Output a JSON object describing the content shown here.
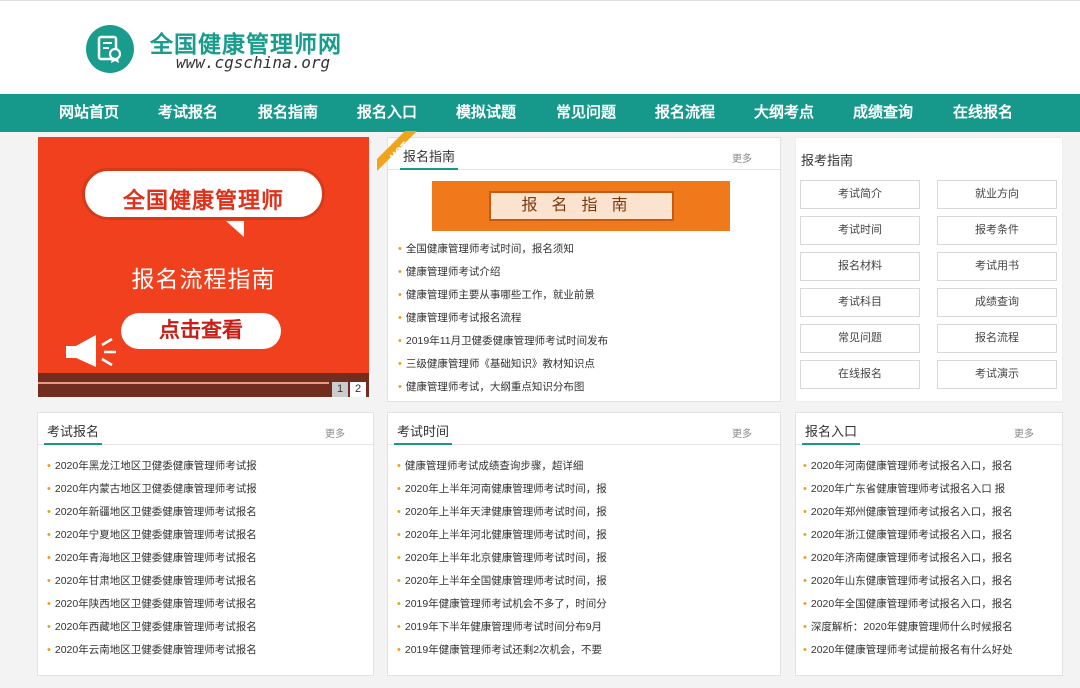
{
  "header": {
    "site_title": "全国健康管理师网",
    "site_url": "www.cgschina.org",
    "logo_icon": "certificate-icon",
    "brand_color": "#16998a"
  },
  "nav": [
    "网站首页",
    "考试报名",
    "报名指南",
    "报名入口",
    "模拟试题",
    "常见问题",
    "报名流程",
    "大纲考点",
    "成绩查询",
    "在线报名"
  ],
  "banner": {
    "bubble_text": "全国健康管理师",
    "subtitle": "报名流程指南",
    "button": "点击查看",
    "slides": [
      "1",
      "2"
    ]
  },
  "guide_panel": {
    "badge": "HOT",
    "title": "报名指南",
    "more": "更多",
    "banner_text": "报名指南",
    "items": [
      "全国健康管理师考试时间，报名须知",
      "健康管理师考试介绍",
      "健康管理师主要从事哪些工作，就业前景",
      "健康管理师考试报名流程",
      "2019年11月卫健委健康管理师考试时间发布",
      "三级健康管理师《基础知识》教材知识点",
      "健康管理师考试，大纲重点知识分布图"
    ]
  },
  "side_guide": {
    "title": "报考指南",
    "buttons": [
      "考试简介",
      "就业方向",
      "考试时间",
      "报考条件",
      "报名材料",
      "考试用书",
      "考试科目",
      "成绩查询",
      "常见问题",
      "报名流程",
      "在线报名",
      "考试演示"
    ]
  },
  "exam_registration": {
    "title": "考试报名",
    "more": "更多",
    "items": [
      "2020年黑龙江地区卫健委健康管理师考试报",
      "2020年内蒙古地区卫健委健康管理师考试报",
      "2020年新疆地区卫健委健康管理师考试报名",
      "2020年宁夏地区卫健委健康管理师考试报名",
      "2020年青海地区卫健委健康管理师考试报名",
      "2020年甘肃地区卫健委健康管理师考试报名",
      "2020年陕西地区卫健委健康管理师考试报名",
      "2020年西藏地区卫健委健康管理师考试报名",
      "2020年云南地区卫健委健康管理师考试报名"
    ]
  },
  "exam_time": {
    "title": "考试时间",
    "more": "更多",
    "items": [
      "健康管理师考试成绩查询步骤，超详细",
      "2020年上半年河南健康管理师考试时间，报",
      "2020年上半年天津健康管理师考试时间，报",
      "2020年上半年河北健康管理师考试时间，报",
      "2020年上半年北京健康管理师考试时间，报",
      "2020年上半年全国健康管理师考试时间，报",
      "2019年健康管理师考试机会不多了，时间分",
      "2019年下半年健康管理师考试时间分布9月",
      "2019年健康管理师考试还剩2次机会，不要"
    ]
  },
  "registration_entry": {
    "title": "报名入口",
    "more": "更多",
    "items": [
      "2020年河南健康管理师考试报名入口，报名",
      "2020年广东省健康管理师考试报名入口  报",
      "2020年郑州健康管理师考试报名入口，报名",
      "2020年浙江健康管理师考试报名入口，报名",
      "2020年济南健康管理师考试报名入口，报名",
      "2020年山东健康管理师考试报名入口，报名",
      "2020年全国健康管理师考试报名入口，报名",
      "深度解析：2020年健康管理师什么时候报名",
      "2020年健康管理师考试提前报名有什么好处"
    ]
  }
}
